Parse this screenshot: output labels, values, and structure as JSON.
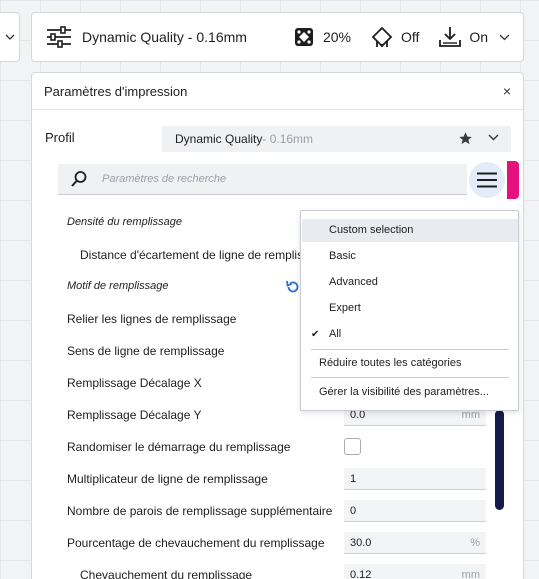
{
  "toolbar": {
    "profile_label": "Dynamic Quality - 0.16mm",
    "infill_value": "20%",
    "support_value": "Off",
    "adhesion_value": "On"
  },
  "panel": {
    "title": "Paramètres d'impression",
    "close_symbol": "×",
    "profile_label": "Profil",
    "profile_name": "Dynamic Quality",
    "profile_suffix": " - 0.16mm",
    "search_placeholder": "Paramètres de recherche"
  },
  "settings": [
    {
      "label": "Densité du remplissage",
      "kind": "category"
    },
    {
      "label": "Distance d'écartement de ligne de remplissage",
      "kind": "indent"
    },
    {
      "label": "Motif de remplissage",
      "kind": "category"
    },
    {
      "label": "Relier les lignes de remplissage"
    },
    {
      "label": "Sens de ligne de remplissage"
    },
    {
      "label": "Remplissage Décalage X"
    },
    {
      "label": "Remplissage Décalage Y",
      "value": "0.0",
      "unit": "mm"
    },
    {
      "label": "Randomiser le démarrage du remplissage"
    },
    {
      "label": "Multiplicateur de ligne de remplissage",
      "value": "1"
    },
    {
      "label": "Nombre de parois de remplissage supplémentaire",
      "value": "0"
    },
    {
      "label": "Pourcentage de chevauchement du remplissage",
      "value": "30.0",
      "unit": "%"
    },
    {
      "label": "Chevauchement du remplissage",
      "value": "0.12",
      "unit": "mm",
      "kind": "indent"
    }
  ],
  "menu": {
    "items": [
      "Custom selection",
      "Basic",
      "Advanced",
      "Expert",
      "All"
    ],
    "check_symbol": "✔",
    "collapse_all": "Réduire toutes les catégories",
    "manage_visibility": "Gérer la visibilité des paramètres..."
  },
  "colors": {
    "accent_pink": "#e5117f",
    "scrollbar": "#141a4a",
    "menu_button_bg": "#e3ecf8"
  }
}
